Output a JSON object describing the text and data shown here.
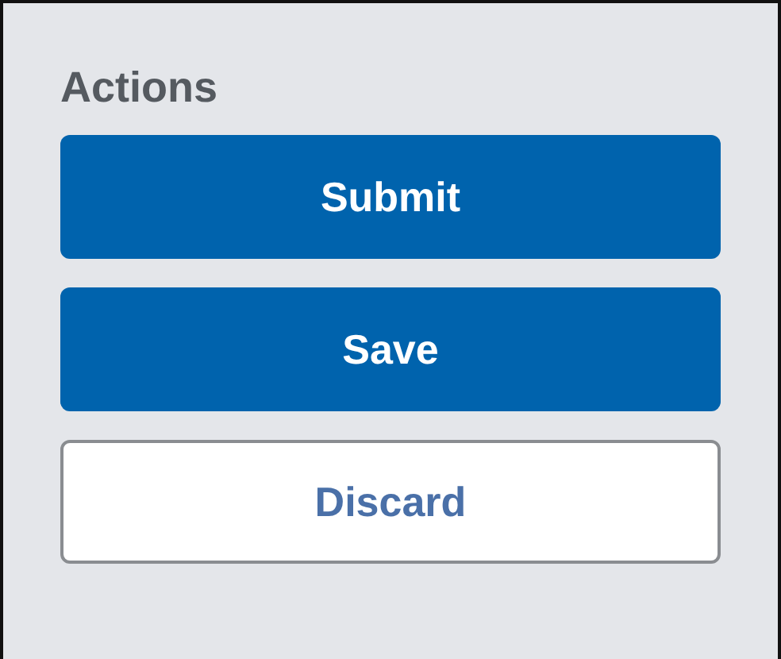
{
  "panel": {
    "title": "Actions",
    "buttons": [
      {
        "label": "Submit",
        "kind": "primary"
      },
      {
        "label": "Save",
        "kind": "primary"
      },
      {
        "label": "Discard",
        "kind": "secondary"
      }
    ]
  }
}
